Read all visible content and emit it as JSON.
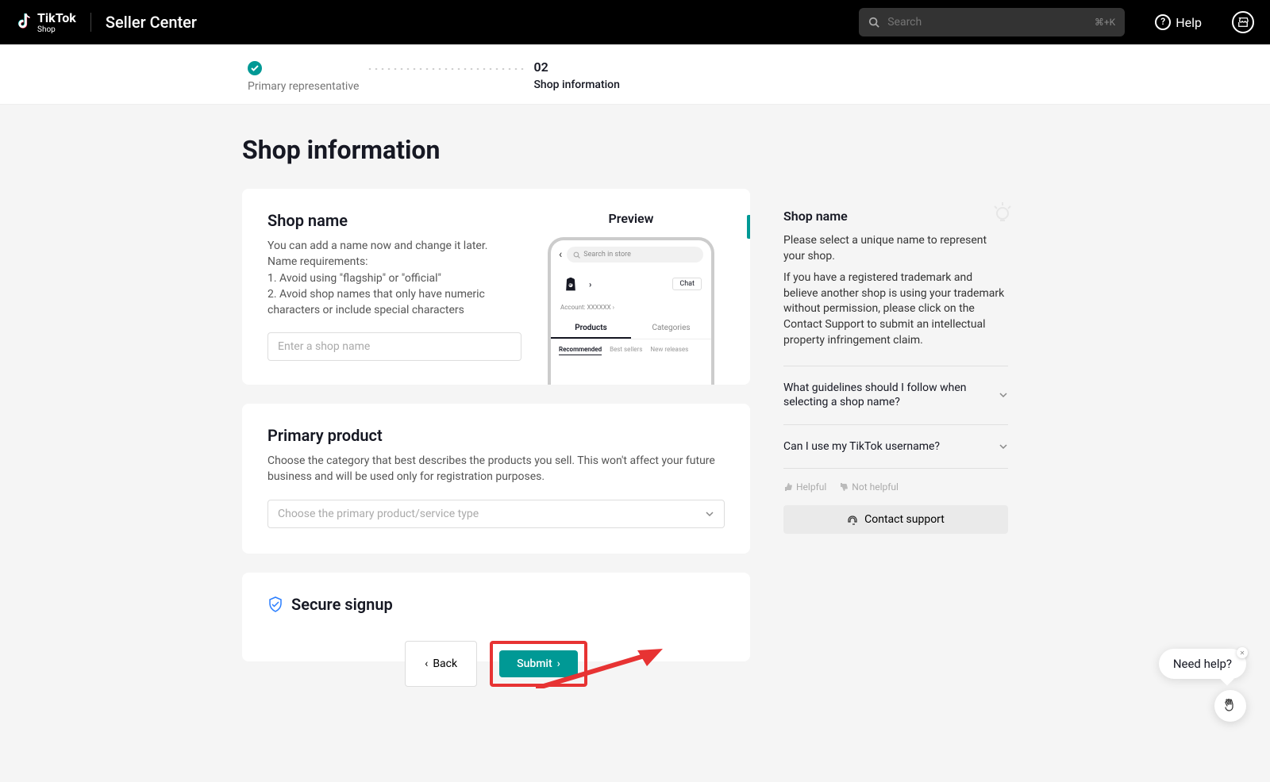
{
  "header": {
    "brand": "TikTok",
    "brand_sub": "Shop",
    "seller_center": "Seller Center",
    "search_placeholder": "Search",
    "search_kbd": "⌘+K",
    "help": "Help"
  },
  "steps": {
    "step1_label": "Primary representative",
    "step2_num": "02",
    "step2_label": "Shop information"
  },
  "page_title": "Shop information",
  "shop_name_section": {
    "title": "Shop name",
    "desc_line1": "You can add a name now and change it later.",
    "desc_line2": "Name requirements:",
    "desc_line3": "1. Avoid using \"flagship\" or \"official\"",
    "desc_line4": "2. Avoid shop names that only have numeric characters or include special characters",
    "input_placeholder": "Enter a shop name"
  },
  "preview": {
    "title": "Preview",
    "search_placeholder": "Search in store",
    "chat": "Chat",
    "account": "Account: XXXXXX ›",
    "tab_products": "Products",
    "tab_categories": "Categories",
    "subtab_recommended": "Recommended",
    "subtab_best": "Best sellers",
    "subtab_new": "New releases"
  },
  "primary_product": {
    "title": "Primary product",
    "desc": "Choose the category that best describes the products you sell. This won't affect your future business and will be used only for registration purposes.",
    "placeholder": "Choose the primary product/service type"
  },
  "secure": {
    "title": "Secure signup"
  },
  "buttons": {
    "back": "Back",
    "submit": "Submit"
  },
  "side": {
    "title": "Shop name",
    "p1": "Please select a unique name to represent your shop.",
    "p2": "If you have a registered trademark and believe another shop is using your trademark without permission, please click on the Contact Support to submit an intellectual property infringement claim.",
    "faq1": "What guidelines should I follow when selecting a shop name?",
    "faq2": "Can I use my TikTok username?",
    "helpful": "Helpful",
    "not_helpful": "Not helpful",
    "contact": "Contact support"
  },
  "widget": {
    "need_help": "Need help?"
  }
}
